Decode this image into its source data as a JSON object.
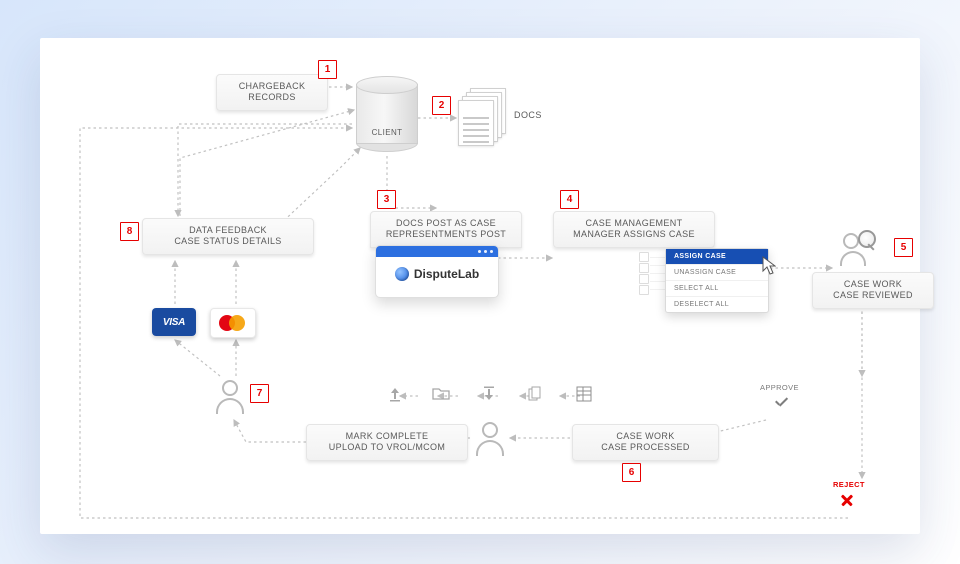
{
  "steps": {
    "s1": {
      "num": "1",
      "line1": "CHARGEBACK",
      "line2": "RECORDS"
    },
    "s2": {
      "num": "2",
      "client": "CLIENT",
      "docs": "DOCS"
    },
    "s3": {
      "num": "3",
      "line1": "DOCS POST AS CASE",
      "line2": "REPRESENTMENTS POST",
      "brand": "DisputeLab"
    },
    "s4": {
      "num": "4",
      "line1": "CASE MANAGEMENT",
      "line2": "MANAGER ASSIGNS CASE"
    },
    "s5": {
      "num": "5",
      "line1": "CASE WORK",
      "line2": "CASE REVIEWED"
    },
    "s6": {
      "num": "6",
      "line1": "CASE WORK",
      "line2": "CASE PROCESSED"
    },
    "s7": {
      "num": "7",
      "line1": "MARK COMPLETE",
      "line2": "UPLOAD TO VROL/MCOM"
    },
    "s8": {
      "num": "8",
      "line1": "DATA FEEDBACK",
      "line2": "CASE STATUS DETAILS"
    }
  },
  "menu": {
    "m1": "ASSIGN CASE",
    "m2": "UNASSIGN CASE",
    "m3": "SELECT ALL",
    "m4": "DESELECT ALL"
  },
  "labels": {
    "approve": "APPROVE",
    "reject": "REJECT",
    "visa": "VISA"
  },
  "sequence": [
    "1",
    "2",
    "3",
    "4",
    "5",
    "6",
    "7",
    "8"
  ]
}
